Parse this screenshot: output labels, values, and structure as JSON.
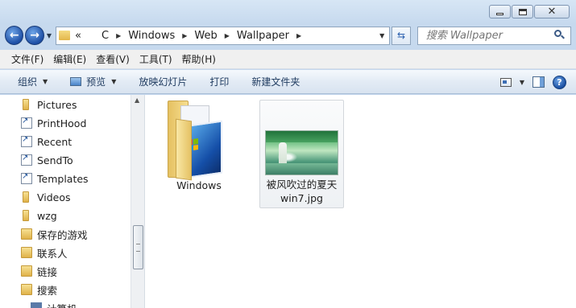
{
  "address": {
    "prefix": "«",
    "crumbs": [
      "C",
      "Windows",
      "Web",
      "Wallpaper"
    ]
  },
  "search": {
    "placeholder": "搜索 Wallpaper"
  },
  "menu": [
    "文件(F)",
    "编辑(E)",
    "查看(V)",
    "工具(T)",
    "帮助(H)"
  ],
  "toolbar": {
    "organize": "组织",
    "preview": "预览",
    "slideshow": "放映幻灯片",
    "print": "打印",
    "new_folder": "新建文件夹"
  },
  "nav_items": [
    {
      "label": "Pictures",
      "icon": "folder-icon"
    },
    {
      "label": "PrintHood",
      "icon": "shortcut-icon"
    },
    {
      "label": "Recent",
      "icon": "shortcut-icon"
    },
    {
      "label": "SendTo",
      "icon": "shortcut-icon"
    },
    {
      "label": "Templates",
      "icon": "shortcut-icon"
    },
    {
      "label": "Videos",
      "icon": "folder-icon"
    },
    {
      "label": "wzg",
      "icon": "folder-icon"
    },
    {
      "label": "保存的游戏",
      "icon": "saved-games-icon"
    },
    {
      "label": "联系人",
      "icon": "contacts-icon"
    },
    {
      "label": "链接",
      "icon": "links-icon"
    },
    {
      "label": "搜索",
      "icon": "searches-icon"
    }
  ],
  "nav_partial": "计算机",
  "files": {
    "folder_name": "Windows",
    "image_name_line1": "被风吹过的夏天",
    "image_name_line2": "win7.jpg"
  }
}
